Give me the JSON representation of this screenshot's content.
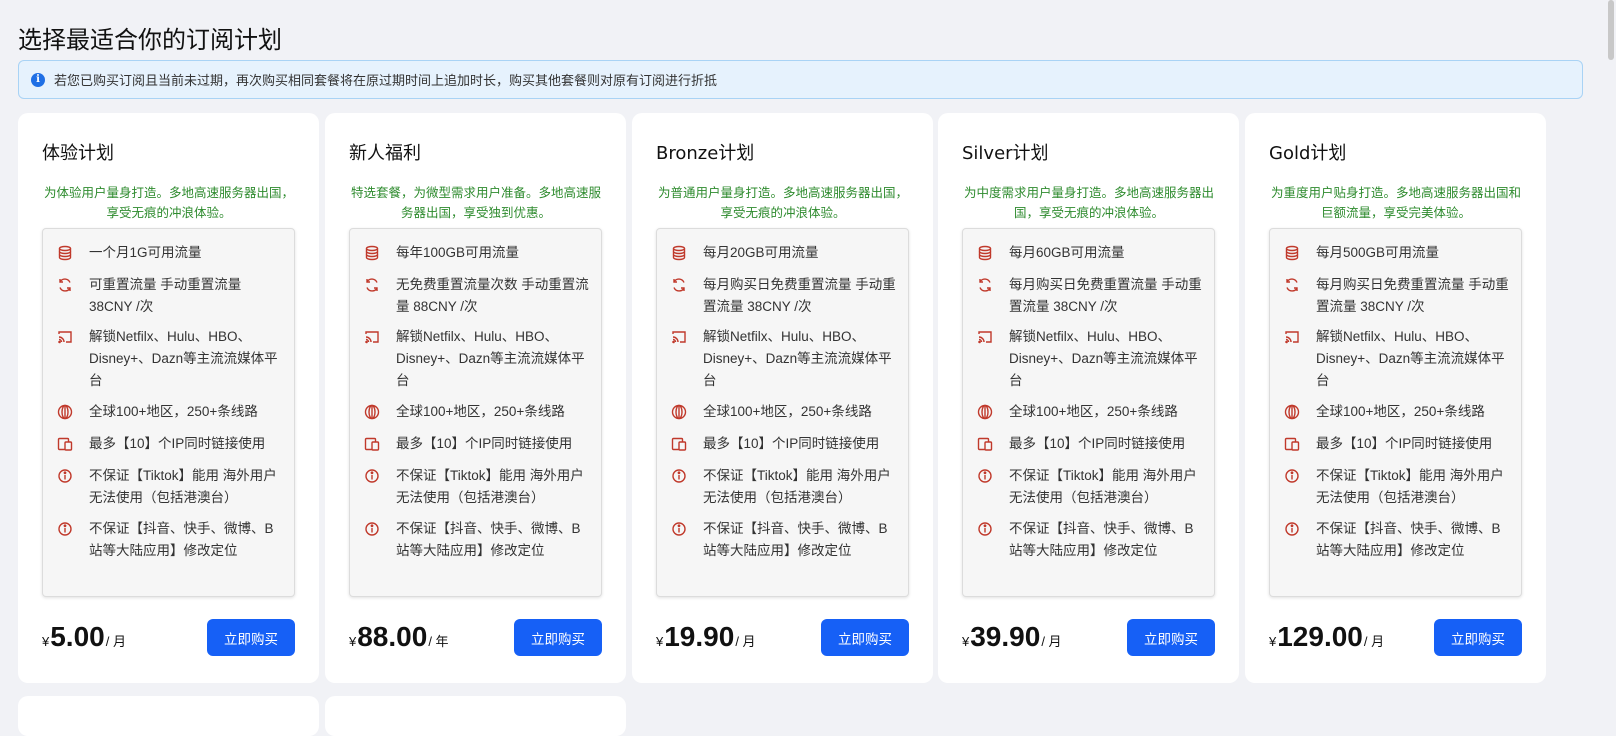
{
  "page": {
    "title": "选择最适合你的订阅计划",
    "notice": "若您已购买订阅且当前未过期，再次购买相同套餐将在原过期时间上追加时长，购买其他套餐则对原有订阅进行折抵"
  },
  "buy_label": "立即购买",
  "currency": "¥",
  "plans": [
    {
      "name": "体验计划",
      "desc": "为体验用户量身打造。多地高速服务器出国，享受无痕的冲浪体验。",
      "features": [
        "一个月1G可用流量",
        "可重置流量 手动重置流量 38CNY /次",
        "解锁Netfilx、Hulu、HBO、Disney+、Dazn等主流流媒体平台",
        "全球100+地区，250+条线路",
        "最多【10】个IP同时链接使用",
        "不保证【Tiktok】能用 海外用户无法使用（包括港澳台）",
        "不保证【抖音、快手、微博、B站等大陆应用】修改定位"
      ],
      "price": "5.00",
      "period": "/ 月"
    },
    {
      "name": "新人福利",
      "desc": "特选套餐，为微型需求用户准备。多地高速服务器出国，享受独到优惠。",
      "features": [
        "每年100GB可用流量",
        "无免费重置流量次数 手动重置流量 88CNY /次",
        "解锁Netfilx、Hulu、HBO、Disney+、Dazn等主流流媒体平台",
        "全球100+地区，250+条线路",
        "最多【10】个IP同时链接使用",
        "不保证【Tiktok】能用 海外用户无法使用（包括港澳台）",
        "不保证【抖音、快手、微博、B站等大陆应用】修改定位"
      ],
      "price": "88.00",
      "period": "/ 年"
    },
    {
      "name": "Bronze计划",
      "desc": "为普通用户量身打造。多地高速服务器出国，享受无痕的冲浪体验。",
      "features": [
        "每月20GB可用流量",
        "每月购买日免费重置流量 手动重置流量 38CNY /次",
        "解锁Netfilx、Hulu、HBO、Disney+、Dazn等主流流媒体平台",
        "全球100+地区，250+条线路",
        "最多【10】个IP同时链接使用",
        "不保证【Tiktok】能用 海外用户无法使用（包括港澳台）",
        "不保证【抖音、快手、微博、B站等大陆应用】修改定位"
      ],
      "price": "19.90",
      "period": "/ 月"
    },
    {
      "name": "Silver计划",
      "desc": "为中度需求用户量身打造。多地高速服务器出国，享受无痕的冲浪体验。",
      "features": [
        "每月60GB可用流量",
        "每月购买日免费重置流量 手动重置流量 38CNY /次",
        "解锁Netfilx、Hulu、HBO、Disney+、Dazn等主流流媒体平台",
        "全球100+地区，250+条线路",
        "最多【10】个IP同时链接使用",
        "不保证【Tiktok】能用 海外用户无法使用（包括港澳台）",
        "不保证【抖音、快手、微博、B站等大陆应用】修改定位"
      ],
      "price": "39.90",
      "period": "/ 月"
    },
    {
      "name": "Gold计划",
      "desc": "为重度用户贴身打造。多地高速服务器出国和巨额流量，享受完美体验。",
      "features": [
        "每月500GB可用流量",
        "每月购买日免费重置流量 手动重置流量 38CNY /次",
        "解锁Netfilx、Hulu、HBO、Disney+、Dazn等主流流媒体平台",
        "全球100+地区，250+条线路",
        "最多【10】个IP同时链接使用",
        "不保证【Tiktok】能用 海外用户无法使用（包括港澳台）",
        "不保证【抖音、快手、微博、B站等大陆应用】修改定位"
      ],
      "price": "129.00",
      "period": "/ 月"
    }
  ],
  "feature_icons": [
    "database-icon",
    "refresh-icon",
    "cast-icon",
    "globe-icon",
    "devices-icon",
    "info-icon",
    "info-icon"
  ],
  "colors": {
    "accent": "#1660f6",
    "desc_green": "#2e8b2e",
    "icon_red": "#c0392b",
    "notice_bg": "#e6f2fd"
  }
}
